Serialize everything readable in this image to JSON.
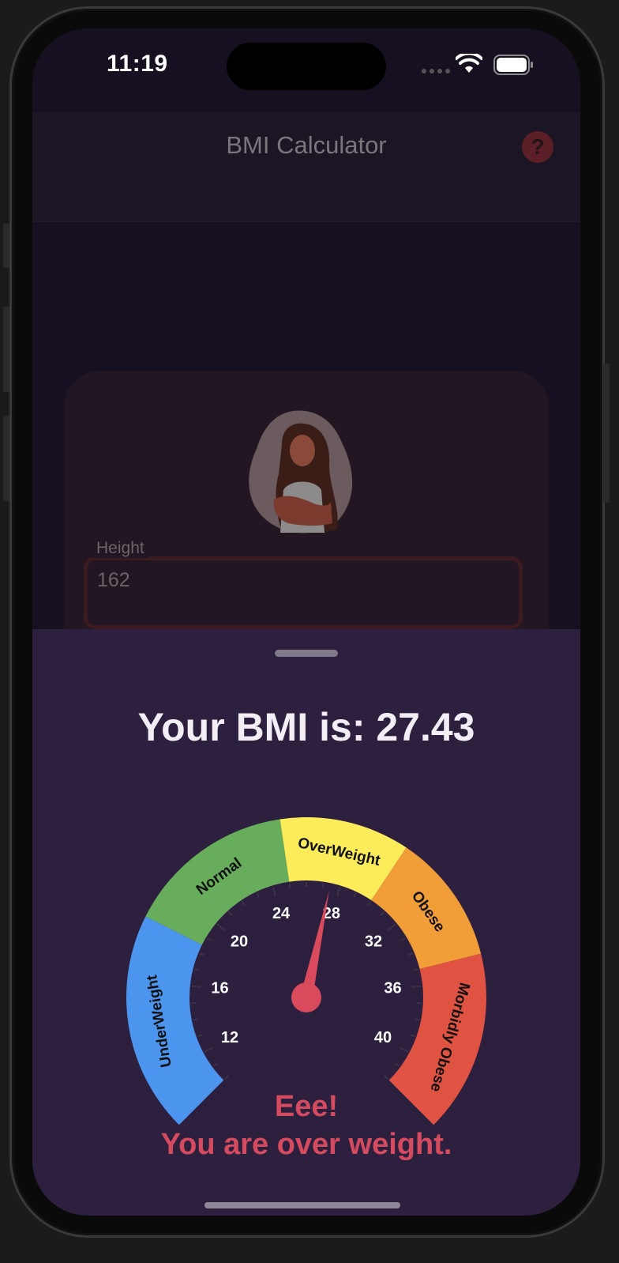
{
  "status_bar": {
    "time": "11:19",
    "icons": [
      "cellular-signal-icon",
      "wifi-icon",
      "battery-icon"
    ]
  },
  "app_bar": {
    "title": "BMI Calculator",
    "help_icon": "?"
  },
  "form": {
    "height_label": "Height",
    "height_value": "162"
  },
  "result_sheet": {
    "title": "Your BMI is: 27.43",
    "bmi": 27.43,
    "verdict_line1": "Eee!",
    "verdict_line2": "You are over weight."
  },
  "gauge": {
    "min": 10,
    "max": 42,
    "segments": [
      {
        "label": "UnderWeight",
        "from": 10,
        "to": 18.5,
        "color": "#4c95ee"
      },
      {
        "label": "Normal",
        "from": 18.5,
        "to": 25,
        "color": "#67ad5b"
      },
      {
        "label": "OverWeight",
        "from": 25,
        "to": 30,
        "color": "#fcec5a"
      },
      {
        "label": "Obese",
        "from": 30,
        "to": 35,
        "color": "#f19d38"
      },
      {
        "label": "Morbidly Obese",
        "from": 35,
        "to": 42,
        "color": "#e05242"
      }
    ],
    "tick_labels": [
      12,
      16,
      20,
      24,
      28,
      32,
      36,
      40
    ],
    "needle_value": 27.43,
    "needle_color": "#d94a5c"
  },
  "colors": {
    "sheet_background": "#2d1f3e",
    "verdict": "#d44b5f",
    "title": "#f3eef6"
  }
}
